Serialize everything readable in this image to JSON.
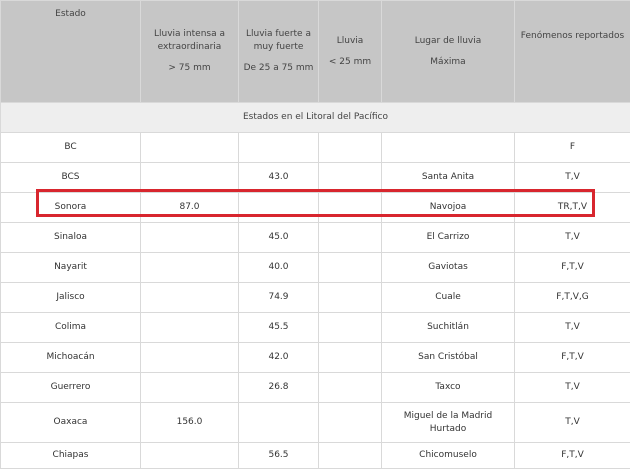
{
  "colors": {
    "highlight": "#d8262e",
    "header_bg": "#c6c6c6",
    "section_bg": "#eeeeee"
  },
  "header": {
    "estado": "Estado",
    "intensa": {
      "line1": "Lluvia intensa a",
      "line2": "extraordinaria",
      "range": "> 75 mm"
    },
    "fuerte": {
      "line1": "Lluvia fuerte a",
      "line2": "muy fuerte",
      "range": "De 25 a 75 mm"
    },
    "lluvia": {
      "line1": "Lluvia",
      "range": "< 25 mm"
    },
    "lugar": {
      "line1": "Lugar de lluvia",
      "line2": "Máxima"
    },
    "fenomenos": "Fenómenos reportados"
  },
  "section_title": "Estados en el Litoral del Pacífico",
  "rows": [
    {
      "estado": "BC",
      "intensa": "",
      "fuerte": "",
      "lluvia": "",
      "lugar": "",
      "fenomenos": "F"
    },
    {
      "estado": "BCS",
      "intensa": "",
      "fuerte": "43.0",
      "lluvia": "",
      "lugar": "Santa Anita",
      "fenomenos": "T,V"
    },
    {
      "estado": "Sonora",
      "intensa": "87.0",
      "fuerte": "",
      "lluvia": "",
      "lugar": "Navojoa",
      "fenomenos": "TR,T,V"
    },
    {
      "estado": "Sinaloa",
      "intensa": "",
      "fuerte": "45.0",
      "lluvia": "",
      "lugar": "El Carrizo",
      "fenomenos": "T,V"
    },
    {
      "estado": "Nayarit",
      "intensa": "",
      "fuerte": "40.0",
      "lluvia": "",
      "lugar": "Gaviotas",
      "fenomenos": "F,T,V"
    },
    {
      "estado": "Jalisco",
      "intensa": "",
      "fuerte": "74.9",
      "lluvia": "",
      "lugar": "Cuale",
      "fenomenos": "F,T,V,G"
    },
    {
      "estado": "Colima",
      "intensa": "",
      "fuerte": "45.5",
      "lluvia": "",
      "lugar": "Suchitlán",
      "fenomenos": "T,V"
    },
    {
      "estado": "Michoacán",
      "intensa": "",
      "fuerte": "42.0",
      "lluvia": "",
      "lugar": "San Cristóbal",
      "fenomenos": "F,T,V"
    },
    {
      "estado": "Guerrero",
      "intensa": "",
      "fuerte": "26.8",
      "lluvia": "",
      "lugar": "Taxco",
      "fenomenos": "T,V"
    },
    {
      "estado": "Oaxaca",
      "intensa": "156.0",
      "fuerte": "",
      "lluvia": "",
      "lugar_line1": "Miguel de la Madrid",
      "lugar_line2": "Hurtado",
      "fenomenos": "T,V"
    },
    {
      "estado": "Chiapas",
      "intensa": "",
      "fuerte": "56.5",
      "lluvia": "",
      "lugar": "Chicomuselo",
      "fenomenos": "F,T,V"
    }
  ]
}
